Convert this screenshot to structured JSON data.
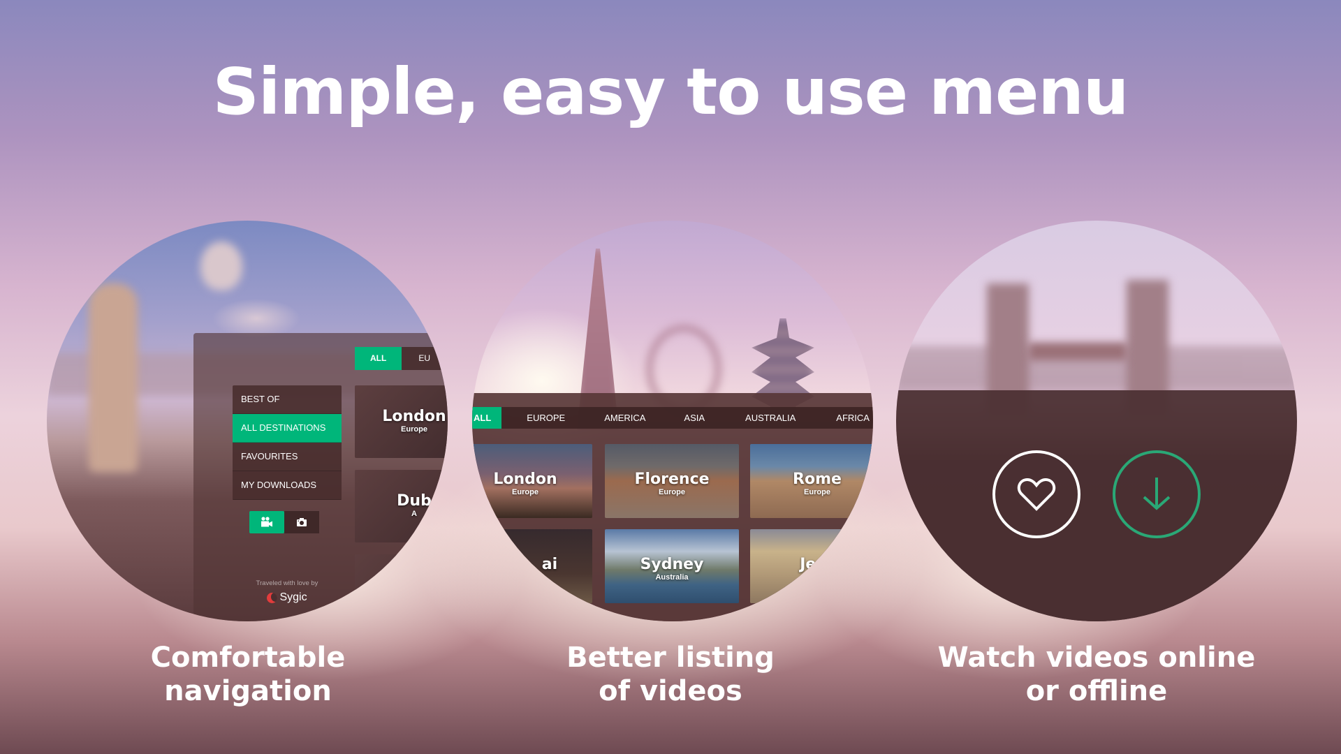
{
  "headline": "Simple, easy to use menu",
  "colors": {
    "accent": "#00b67a",
    "download_ring": "#2aa876",
    "panel": "#4a3032"
  },
  "features": [
    {
      "caption_line1": "Comfortable",
      "caption_line2": "navigation"
    },
    {
      "caption_line1": "Better listing",
      "caption_line2": "of videos"
    },
    {
      "caption_line1": "Watch videos online",
      "caption_line2": "or offline"
    }
  ],
  "nav_panel": {
    "menu": [
      {
        "label": "BEST OF",
        "active": false
      },
      {
        "label": "ALL DESTINATIONS",
        "active": true
      },
      {
        "label": "FAVOURITES",
        "active": false
      },
      {
        "label": "MY DOWNLOADS",
        "active": false
      }
    ],
    "media_toggle": [
      {
        "icon": "video-camera-icon",
        "active": true
      },
      {
        "icon": "photo-camera-icon",
        "active": false
      }
    ],
    "tabs": [
      "ALL",
      "EU"
    ],
    "cards": [
      {
        "title": "London",
        "region": "Europe"
      },
      {
        "title": "Dub",
        "region": "A"
      }
    ],
    "credit": "Traveled with love by",
    "brand": "Sygic"
  },
  "listing_panel": {
    "tabs": [
      "ALL",
      "EUROPE",
      "AMERICA",
      "ASIA",
      "AUSTRALIA",
      "AFRICA"
    ],
    "active_tab": "ALL",
    "cards": [
      {
        "title": "London",
        "region": "Europe"
      },
      {
        "title": "Florence",
        "region": "Europe"
      },
      {
        "title": "Rome",
        "region": "Europe"
      },
      {
        "title": "ai",
        "region": ""
      },
      {
        "title": "Sydney",
        "region": "Australia"
      },
      {
        "title": "Jeru",
        "region": ""
      }
    ]
  },
  "video_actions": {
    "favourite_icon": "heart-icon",
    "download_icon": "download-arrow-icon"
  }
}
